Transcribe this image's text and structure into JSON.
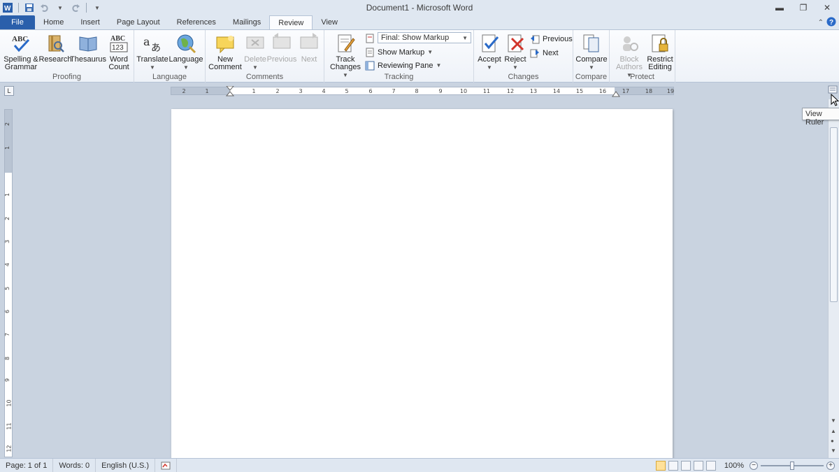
{
  "window": {
    "title": "Document1  -  Microsoft Word"
  },
  "tabs": [
    {
      "label": "File"
    },
    {
      "label": "Home"
    },
    {
      "label": "Insert"
    },
    {
      "label": "Page Layout"
    },
    {
      "label": "References"
    },
    {
      "label": "Mailings"
    },
    {
      "label": "Review"
    },
    {
      "label": "View"
    }
  ],
  "ribbon": {
    "proofing": {
      "label": "Proofing",
      "spelling_line1": "Spelling &",
      "spelling_line2": "Grammar",
      "research": "Research",
      "thesaurus": "Thesaurus",
      "wordcount_line1": "Word",
      "wordcount_line2": "Count"
    },
    "language": {
      "label": "Language",
      "translate": "Translate",
      "language": "Language"
    },
    "comments": {
      "label": "Comments",
      "new_line1": "New",
      "new_line2": "Comment",
      "delete": "Delete",
      "previous": "Previous",
      "next": "Next"
    },
    "tracking": {
      "label": "Tracking",
      "track_line1": "Track",
      "track_line2": "Changes",
      "markup_select": "Final: Show Markup",
      "show_markup": "Show Markup",
      "reviewing_pane": "Reviewing Pane"
    },
    "changes": {
      "label": "Changes",
      "accept": "Accept",
      "reject": "Reject",
      "previous": "Previous",
      "next": "Next"
    },
    "compare": {
      "label": "Compare",
      "compare": "Compare"
    },
    "protect": {
      "label": "Protect",
      "block_line1": "Block",
      "block_line2": "Authors",
      "restrict_line1": "Restrict",
      "restrict_line2": "Editing"
    }
  },
  "ruler": {
    "marks": [
      "2",
      "1",
      "1",
      "2",
      "3",
      "4",
      "5",
      "6",
      "7",
      "8",
      "9",
      "10",
      "11",
      "12",
      "13",
      "14",
      "15",
      "16",
      "17",
      "18",
      "19"
    ],
    "vmarks": [
      "2",
      "1",
      "1",
      "2",
      "3",
      "4",
      "5",
      "6",
      "7",
      "8",
      "9",
      "10",
      "11",
      "12"
    ]
  },
  "tooltip": {
    "text": "View Ruler"
  },
  "statusbar": {
    "page": "Page: 1 of 1",
    "words": "Words: 0",
    "language": "English (U.S.)",
    "zoom": "100%"
  },
  "colors": {
    "file_tab": "#2a5fab",
    "chrome": "#dfe7f1",
    "workspace": "#c9d3e0"
  }
}
